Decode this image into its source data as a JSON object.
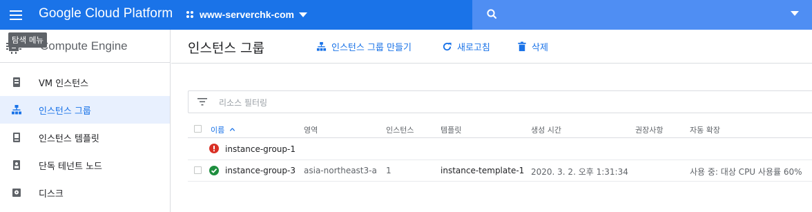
{
  "header": {
    "app_title": "Google Cloud Platform",
    "project_name": "www-serverchk-com",
    "menu_tooltip": "탐색 메뉴"
  },
  "sidebar": {
    "product": "Compute Engine",
    "items": [
      {
        "label": "VM 인스턴스",
        "icon": "vm-instance-icon",
        "active": false
      },
      {
        "label": "인스턴스 그룹",
        "icon": "instance-group-icon",
        "active": true
      },
      {
        "label": "인스턴스 템플릿",
        "icon": "instance-template-icon",
        "active": false
      },
      {
        "label": "단독 테넌트 노드",
        "icon": "sole-tenant-node-icon",
        "active": false
      },
      {
        "label": "디스크",
        "icon": "disk-icon",
        "active": false
      }
    ]
  },
  "main": {
    "title": "인스턴스 그룹",
    "actions": {
      "create": "인스턴스 그룹 만들기",
      "refresh": "새로고침",
      "delete": "삭제"
    },
    "filter_placeholder": "리소스 필터링"
  },
  "table": {
    "columns": {
      "name": "이름",
      "zone": "영역",
      "instances": "인스턴스",
      "template": "템플릿",
      "created": "생성 시간",
      "recommendation": "권장사항",
      "autoscale": "자동 확장"
    },
    "rows": [
      {
        "status": "error",
        "name": "instance-group-1",
        "zone": "",
        "instances": "",
        "template": "",
        "created": "",
        "recommendation": "",
        "autoscale": ""
      },
      {
        "status": "ok",
        "name": "instance-group-3",
        "zone": "asia-northeast3-a",
        "instances": "1",
        "template": "instance-template-1",
        "created": "2020. 3. 2. 오후 1:31:34",
        "recommendation": "",
        "autoscale": "사용 중: 대상 CPU 사용률 60%"
      }
    ]
  },
  "colors": {
    "brand_blue": "#1a73e8",
    "search_bg": "#4f8ef3",
    "error_red": "#d93025",
    "ok_green": "#1e8e3e",
    "active_bg": "#e8f0fe"
  }
}
